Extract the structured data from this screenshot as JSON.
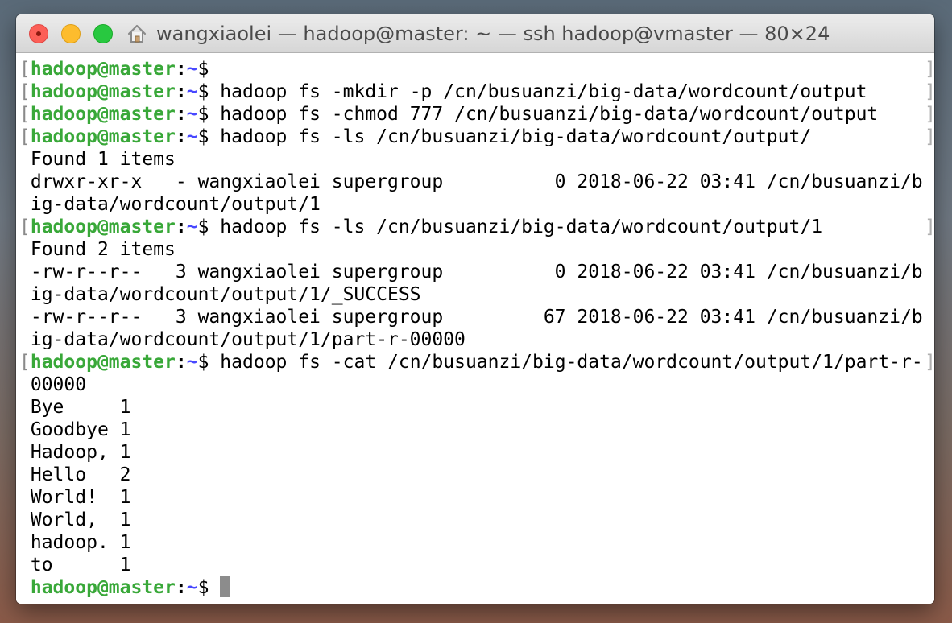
{
  "window": {
    "title": "wangxiaolei — hadoop@master: ~ — ssh hadoop@vmaster — 80×24"
  },
  "prompt": {
    "user_host": "hadoop@master",
    "colon": ":",
    "path": "~",
    "symbol": "$"
  },
  "terminal": {
    "lines": [
      {
        "type": "prompt",
        "command": ""
      },
      {
        "type": "prompt",
        "command": " hadoop fs -mkdir -p /cn/busuanzi/big-data/wordcount/output"
      },
      {
        "type": "prompt",
        "command": " hadoop fs -chmod 777 /cn/busuanzi/big-data/wordcount/output"
      },
      {
        "type": "prompt",
        "command": " hadoop fs -ls /cn/busuanzi/big-data/wordcount/output/"
      },
      {
        "type": "output",
        "text": "Found 1 items"
      },
      {
        "type": "output",
        "text": "drwxr-xr-x   - wangxiaolei supergroup          0 2018-06-22 03:41 /cn/busuanzi/b"
      },
      {
        "type": "output",
        "text": "ig-data/wordcount/output/1"
      },
      {
        "type": "prompt",
        "command": " hadoop fs -ls /cn/busuanzi/big-data/wordcount/output/1"
      },
      {
        "type": "output",
        "text": "Found 2 items"
      },
      {
        "type": "output",
        "text": "-rw-r--r--   3 wangxiaolei supergroup          0 2018-06-22 03:41 /cn/busuanzi/b"
      },
      {
        "type": "output",
        "text": "ig-data/wordcount/output/1/_SUCCESS"
      },
      {
        "type": "output",
        "text": "-rw-r--r--   3 wangxiaolei supergroup         67 2018-06-22 03:41 /cn/busuanzi/b"
      },
      {
        "type": "output",
        "text": "ig-data/wordcount/output/1/part-r-00000"
      },
      {
        "type": "prompt",
        "command": " hadoop fs -cat /cn/busuanzi/big-data/wordcount/output/1/part-r-"
      },
      {
        "type": "output",
        "text": "00000"
      },
      {
        "type": "output",
        "text": "Bye     1"
      },
      {
        "type": "output",
        "text": "Goodbye 1"
      },
      {
        "type": "output",
        "text": "Hadoop, 1"
      },
      {
        "type": "output",
        "text": "Hello   2"
      },
      {
        "type": "output",
        "text": "World!  1"
      },
      {
        "type": "output",
        "text": "World,  1"
      },
      {
        "type": "output",
        "text": "hadoop. 1"
      },
      {
        "type": "output",
        "text": "to      1"
      },
      {
        "type": "prompt_active",
        "command": " "
      }
    ]
  },
  "colors": {
    "prompt_user": "#39a839",
    "prompt_path": "#4848ff",
    "text": "#000000",
    "cursor": "#8c8c8c"
  }
}
